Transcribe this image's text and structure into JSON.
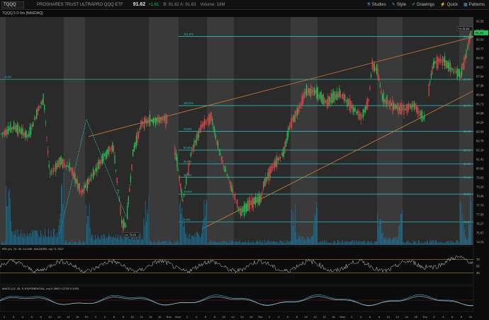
{
  "header": {
    "symbol": "TQQQ",
    "description": "PROSHARES TRUST ULTRAPRO QQQ ETF",
    "price": "91.62",
    "change": "+1.61",
    "bid_ask": "B: 91.62  A: 91.63",
    "volume": "Volume: 18M",
    "tools": [
      {
        "label": "Studies",
        "icon": "flask-icon"
      },
      {
        "label": "Style",
        "icon": "style-icon"
      },
      {
        "label": "Drawings",
        "icon": "pencil-icon"
      },
      {
        "label": "Quick",
        "icon": "quick-icon"
      },
      {
        "label": "Patterns",
        "icon": "patterns-icon"
      }
    ]
  },
  "chart_title": "TQQQ 5 D 5m [NASDAQ]",
  "price_axis": {
    "ticks": [
      "92.55",
      "91.62",
      "90.50",
      "89.77",
      "89.30",
      "88.57",
      "87.84",
      "87.38",
      "86.84",
      "85.71",
      "84.98",
      "84.24",
      "83.59",
      "82.78",
      "82.10",
      "81.41",
      "80.66",
      "79.93",
      "79.20",
      "78.46",
      "77.73",
      "77.04",
      "76.27",
      "75.67",
      "74.70"
    ],
    "last_price": "91.62",
    "hi_label": "Hi: 91.63"
  },
  "fib_levels": [
    {
      "label": "161.8%",
      "value": "91.32"
    },
    {
      "label": "0.0%",
      "value": "87.84"
    },
    {
      "label": "100.0%",
      "value": "85.71"
    },
    {
      "label": "78.6%",
      "value": "83.63"
    },
    {
      "label": "61.8%",
      "value": "82.10"
    },
    {
      "label": "50.0%",
      "value": "80.99"
    },
    {
      "label": "38.2%",
      "value": "79.90"
    },
    {
      "label": "23.6%",
      "value": "78.53"
    },
    {
      "label": "0.0%",
      "value": "76.27"
    }
  ],
  "lo_label": "Lo: 75.23",
  "rsi_label": "RSI (14, 70, 30, CLOSE, WILDERS, no) 71.7427",
  "rsi_ticks": [
    "70",
    "50",
    "30"
  ],
  "macd_label": "MACD (12, 26, 9, EXPONENTIAL, no) 0.3902 0.2733 0.1093",
  "time_axis": [
    "2",
    "3",
    "4",
    "6",
    "8",
    "10",
    "12",
    "14",
    "16",
    "Fri",
    "2",
    "4",
    "6",
    "8",
    "10",
    "12",
    "14",
    "16",
    "Sun",
    "Mon",
    "2",
    "4",
    "6",
    "8",
    "10",
    "12",
    "14",
    "16",
    "Tue",
    "2",
    "4",
    "6",
    "8",
    "10",
    "12",
    "14",
    "16",
    "Wed",
    "2",
    "4",
    "6",
    "8",
    "10",
    "12",
    "14",
    "16",
    "Thu",
    "2",
    "4",
    "6",
    "8",
    "10"
  ],
  "colors": {
    "up": "#27c255",
    "down": "#e0494b",
    "fib": "#2bd0cc",
    "trend": "#d07a3a",
    "volume": "#1f6d8f",
    "shade": "#3a3a3a"
  }
}
